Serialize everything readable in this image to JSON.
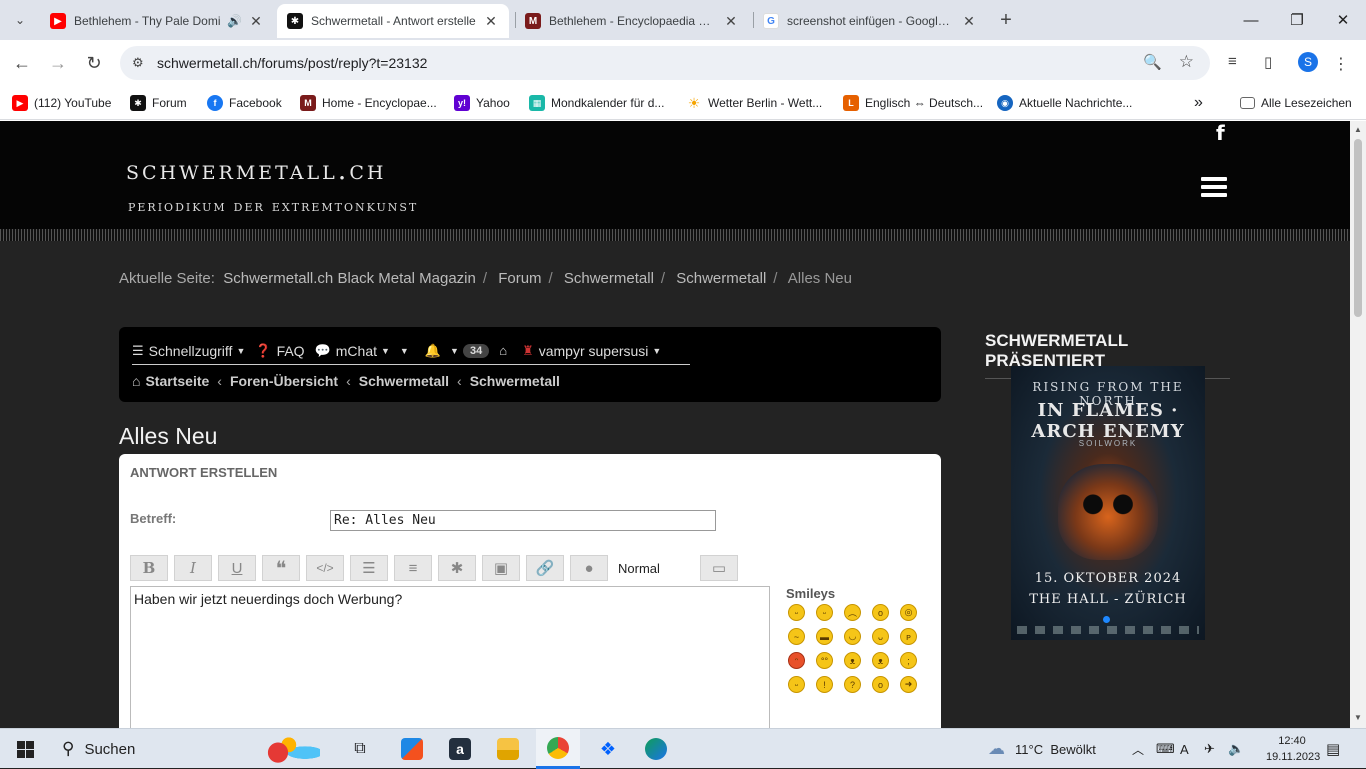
{
  "browser": {
    "tabs": [
      {
        "title": "Bethlehem - Thy Pale Domi",
        "favicon": "youtube-icon",
        "audio": true
      },
      {
        "title": "Schwermetall - Antwort erstelle",
        "favicon": "schwermetall-icon",
        "active": true
      },
      {
        "title": "Bethlehem - Encyclopaedia Met",
        "favicon": "metal-archives-icon"
      },
      {
        "title": "screenshot einfügen - Google S",
        "favicon": "google-icon"
      }
    ],
    "url": "schwermetall.ch/forums/post/reply?t=23132",
    "profile_initial": "S",
    "bookmarks": [
      {
        "label": "(112) YouTube",
        "icon": "youtube-icon"
      },
      {
        "label": "Forum",
        "icon": "forum-icon"
      },
      {
        "label": "Facebook",
        "icon": "facebook-icon"
      },
      {
        "label": "Home - Encyclopae...",
        "icon": "metal-archives-icon"
      },
      {
        "label": "Yahoo",
        "icon": "yahoo-icon"
      },
      {
        "label": "Mondkalender für d...",
        "icon": "calendar-icon"
      },
      {
        "label": "Wetter Berlin - Wett...",
        "icon": "sun-icon"
      },
      {
        "label": "Englisch ⇔ Deutsch...",
        "icon": "dictionary-icon"
      },
      {
        "label": "Aktuelle Nachrichte...",
        "icon": "news-icon"
      }
    ],
    "all_bookmarks": "Alle Lesezeichen"
  },
  "site": {
    "logo_title": "schwermetall.ch",
    "logo_subtitle": "periodikum der extremtonkunst",
    "breadcrumb": {
      "prefix": "Aktuelle Seite:",
      "items": [
        "Schwermetall.ch Black Metal Magazin",
        "Forum",
        "Schwermetall",
        "Schwermetall"
      ],
      "current": "Alles Neu"
    },
    "navbar": {
      "quick_access": "Schnellzugriff",
      "faq": "FAQ",
      "mchat": "mChat",
      "notif_count": "34",
      "username": "vampyr supersusi",
      "crumbs": [
        "Startseite",
        "Foren-Übersicht",
        "Schwermetall",
        "Schwermetall"
      ]
    },
    "page_title": "Alles Neu",
    "form": {
      "heading": "Antwort erstellen",
      "subject_label": "Betreff:",
      "subject_value": "Re: Alles Neu",
      "font_size_select": "Normal",
      "message": "Haben wir jetzt neuerdings doch Werbung?",
      "smileys_title": "Smileys"
    },
    "sidebar": {
      "heading": "SCHWERMETALL PRÄSENTIERT",
      "poster": {
        "line1": "RISING FROM THE NORTH",
        "line2": "IN FLAMES · ARCH ENEMY",
        "line3": "SOILWORK",
        "date": "15. OKTOBER 2024",
        "venue": "THE HALL - ZÜRICH"
      }
    }
  },
  "taskbar": {
    "search": "Suchen",
    "weather_temp": "11°C",
    "weather_text": "Bewölkt",
    "time": "12:40",
    "date": "19.11.2023"
  }
}
